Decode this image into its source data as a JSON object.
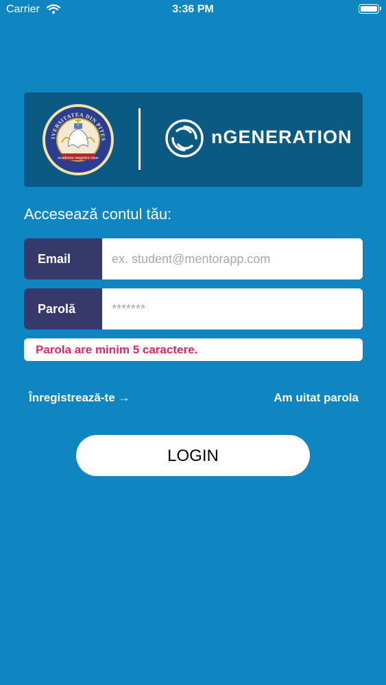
{
  "status_bar": {
    "carrier": "Carrier",
    "time": "3:36 PM"
  },
  "banner": {
    "seal_text_top": "UNIVERSITATEA DIN PITESTI",
    "seal_text_bottom": "academia magistra vitae",
    "brand_name": "nGENERATION"
  },
  "login": {
    "heading": "Accesează contul tău:",
    "email_label": "Email",
    "email_placeholder": "ex. student@mentorapp.com",
    "email_value": "",
    "password_label": "Parolă",
    "password_value": "*******",
    "error_message": "Parola are minim 5 caractere.",
    "register_link": "Înregistrează-te →",
    "forgot_link": "Am uitat parola",
    "login_button": "LOGIN"
  },
  "colors": {
    "background": "#0f86c1",
    "banner": "#0a5a84",
    "label_bg": "#363a6a",
    "error_text": "#e0245e"
  }
}
